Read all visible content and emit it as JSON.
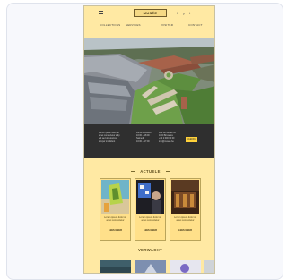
{
  "site": {
    "logo_text": "MUSÉE",
    "social_icons": [
      "f",
      "y",
      "t",
      "i"
    ],
    "nav": [
      "COLLECTIONS",
      "SERVICES",
      "VISITER",
      "CONTACT"
    ],
    "info": {
      "col1": [
        "Lorem ipsum dolor sit",
        "amet consectetur adip",
        "elit sed do eiusmod",
        "tempor incididunt"
      ],
      "col2": [
        "Lundi–vendredi",
        "10:00 – 18:00",
        "Samedi",
        "10:00 – 17:00"
      ],
      "col3": [
        "Rue du Musée 12",
        "1000 Bruxelles",
        "+32 2 000 00 00",
        "info@musee.be"
      ],
      "button_label": "AGENDA"
    },
    "section_actuele": "ACTUELE",
    "cards": [
      {
        "caption": "Lorem ipsum dolor sit amet consectetur",
        "more": "LEES MEER"
      },
      {
        "caption": "Lorem ipsum dolor sit amet consectetur",
        "more": "LEES MEER"
      },
      {
        "caption": "Lorem ipsum dolor sit amet consectetur",
        "more": "LEES MEER"
      }
    ],
    "section_verwacht": "VERWACHT"
  }
}
